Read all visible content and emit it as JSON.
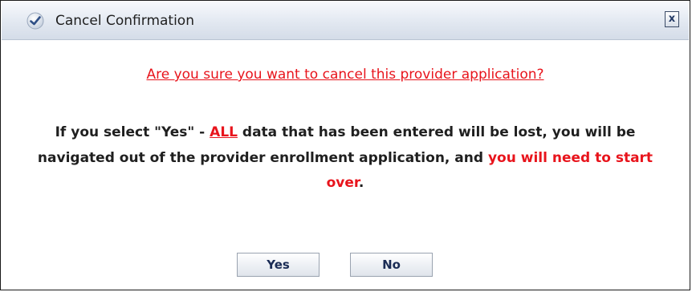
{
  "dialog": {
    "title": "Cancel Confirmation",
    "title_icon": "checkmark-circle-icon",
    "close_glyph": "x",
    "question": "Are you sure you want to cancel this provider application?",
    "message": {
      "part1": "If you select \"Yes\" - ",
      "emphasis": "ALL",
      "part2": " data that has been entered will be lost, you will be navigated out of the provider enrollment application, and ",
      "warning": "you will need to start over",
      "end": "."
    },
    "buttons": {
      "yes": "Yes",
      "no": "No"
    }
  },
  "colors": {
    "warning_red": "#e8141c",
    "text_dark": "#1f1f1f",
    "button_text": "#1a2c55",
    "titlebar_top": "#f7f9fc",
    "titlebar_bottom": "#d4dce8"
  }
}
